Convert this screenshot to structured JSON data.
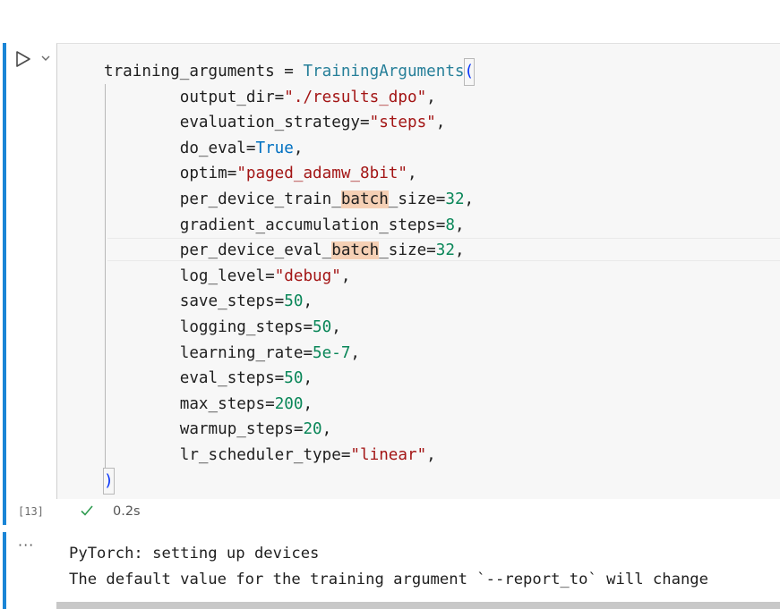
{
  "code_cell": {
    "execution_count": "[13]",
    "exec_time": "0.2s",
    "lines": [
      {
        "indent": 0,
        "tokens": [
          {
            "t": "plain",
            "v": "training_arguments = "
          },
          {
            "t": "cls",
            "v": "TrainingArguments"
          },
          {
            "t": "paren-open",
            "v": "("
          }
        ]
      },
      {
        "indent": 1,
        "tokens": [
          {
            "t": "plain",
            "v": "output_dir="
          },
          {
            "t": "str",
            "v": "\"./results_dpo\""
          },
          {
            "t": "plain",
            "v": ","
          }
        ]
      },
      {
        "indent": 1,
        "tokens": [
          {
            "t": "plain",
            "v": "evaluation_strategy="
          },
          {
            "t": "str",
            "v": "\"steps\""
          },
          {
            "t": "plain",
            "v": ","
          }
        ]
      },
      {
        "indent": 1,
        "tokens": [
          {
            "t": "plain",
            "v": "do_eval="
          },
          {
            "t": "const",
            "v": "True"
          },
          {
            "t": "plain",
            "v": ","
          }
        ]
      },
      {
        "indent": 1,
        "tokens": [
          {
            "t": "plain",
            "v": "optim="
          },
          {
            "t": "str",
            "v": "\"paged_adamw_8bit\""
          },
          {
            "t": "plain",
            "v": ","
          }
        ]
      },
      {
        "indent": 1,
        "tokens": [
          {
            "t": "plain",
            "v": "per_device_train_"
          },
          {
            "t": "hl",
            "v": "batch"
          },
          {
            "t": "plain",
            "v": "_size="
          },
          {
            "t": "num",
            "v": "32"
          },
          {
            "t": "plain",
            "v": ","
          }
        ]
      },
      {
        "indent": 1,
        "tokens": [
          {
            "t": "plain",
            "v": "gradient_accumulation_steps="
          },
          {
            "t": "num",
            "v": "8"
          },
          {
            "t": "plain",
            "v": ","
          }
        ]
      },
      {
        "indent": 1,
        "tokens": [
          {
            "t": "plain",
            "v": "per_device_eval_"
          },
          {
            "t": "hl",
            "v": "batch"
          },
          {
            "t": "plain",
            "v": "_size="
          },
          {
            "t": "num",
            "v": "32"
          },
          {
            "t": "plain",
            "v": ","
          }
        ]
      },
      {
        "indent": 1,
        "tokens": [
          {
            "t": "plain",
            "v": "log_level="
          },
          {
            "t": "str",
            "v": "\"debug\""
          },
          {
            "t": "plain",
            "v": ","
          }
        ]
      },
      {
        "indent": 1,
        "tokens": [
          {
            "t": "plain",
            "v": "save_steps="
          },
          {
            "t": "num",
            "v": "50"
          },
          {
            "t": "plain",
            "v": ","
          }
        ]
      },
      {
        "indent": 1,
        "tokens": [
          {
            "t": "plain",
            "v": "logging_steps="
          },
          {
            "t": "num",
            "v": "50"
          },
          {
            "t": "plain",
            "v": ","
          }
        ]
      },
      {
        "indent": 1,
        "tokens": [
          {
            "t": "plain",
            "v": "learning_rate="
          },
          {
            "t": "num",
            "v": "5e-7"
          },
          {
            "t": "plain",
            "v": ","
          }
        ]
      },
      {
        "indent": 1,
        "tokens": [
          {
            "t": "plain",
            "v": "eval_steps="
          },
          {
            "t": "num",
            "v": "50"
          },
          {
            "t": "plain",
            "v": ","
          }
        ]
      },
      {
        "indent": 1,
        "tokens": [
          {
            "t": "plain",
            "v": "max_steps="
          },
          {
            "t": "num",
            "v": "200"
          },
          {
            "t": "plain",
            "v": ","
          }
        ]
      },
      {
        "indent": 1,
        "tokens": [
          {
            "t": "plain",
            "v": "warmup_steps="
          },
          {
            "t": "num",
            "v": "20"
          },
          {
            "t": "plain",
            "v": ","
          }
        ]
      },
      {
        "indent": 1,
        "tokens": [
          {
            "t": "plain",
            "v": "lr_scheduler_type="
          },
          {
            "t": "str",
            "v": "\"linear\""
          },
          {
            "t": "plain",
            "v": ","
          }
        ]
      },
      {
        "indent": 0,
        "tokens": [
          {
            "t": "paren-close",
            "v": ")"
          }
        ]
      }
    ]
  },
  "output_cell": {
    "ellipsis": "···",
    "lines": [
      "PyTorch: setting up devices",
      "The default value for the training argument `--report_to` will change"
    ]
  },
  "colors": {
    "cell_accent": "#1a85d6",
    "string": "#a31515",
    "number": "#098658",
    "class": "#267f99",
    "constant": "#0070c1",
    "highlight": "#f5d0b5",
    "check": "#2e9b4f"
  },
  "icons": {
    "run": "play-outline-icon",
    "dropdown": "chevron-down-icon",
    "status": "check-icon"
  }
}
